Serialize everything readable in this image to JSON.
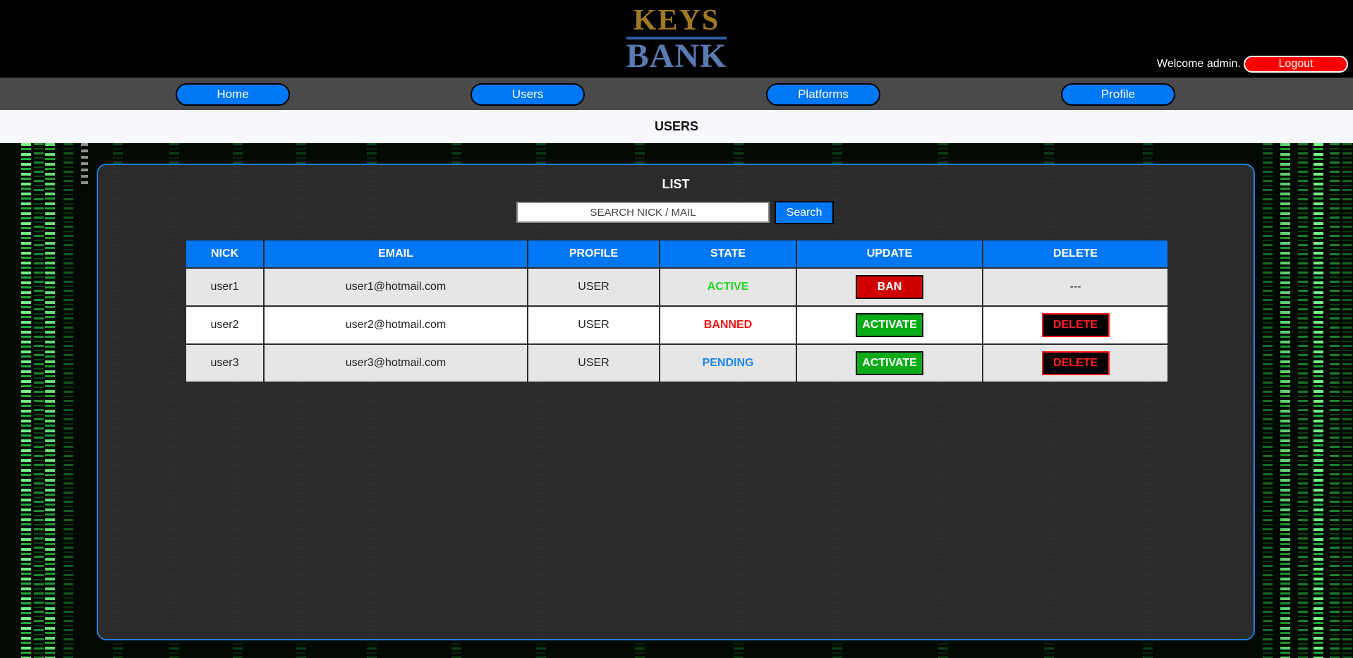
{
  "header": {
    "logo_top": "KEYS",
    "logo_bottom": "BANK",
    "welcome_text": "Welcome admin.",
    "logout_label": "Logout"
  },
  "nav": {
    "items": [
      {
        "label": "Home"
      },
      {
        "label": "Users"
      },
      {
        "label": "Platforms"
      },
      {
        "label": "Profile"
      }
    ]
  },
  "page": {
    "title": "USERS"
  },
  "panel": {
    "title": "LIST",
    "search": {
      "placeholder": "SEARCH NICK / MAIL",
      "value": "",
      "button_label": "Search"
    }
  },
  "table": {
    "headers": [
      "NICK",
      "EMAIL",
      "PROFILE",
      "STATE",
      "UPDATE",
      "DELETE"
    ],
    "rows": [
      {
        "nick": "user1",
        "email": "user1@hotmail.com",
        "profile": "USER",
        "state": "ACTIVE",
        "state_color": "#1fd61f",
        "update": "BAN",
        "delete": "---"
      },
      {
        "nick": "user2",
        "email": "user2@hotmail.com",
        "profile": "USER",
        "state": "BANNED",
        "state_color": "#ee1111",
        "update": "ACTIVATE",
        "delete": "DELETE"
      },
      {
        "nick": "user3",
        "email": "user3@hotmail.com",
        "profile": "USER",
        "state": "PENDING",
        "state_color": "#1a86f0",
        "update": "ACTIVATE",
        "delete": "DELETE"
      }
    ]
  },
  "colors": {
    "accent_blue": "#0077f5",
    "logout_red": "#ff0000",
    "ban_red": "#d10000",
    "activate_green": "#0bab17",
    "delete_red": "#ff2020"
  }
}
